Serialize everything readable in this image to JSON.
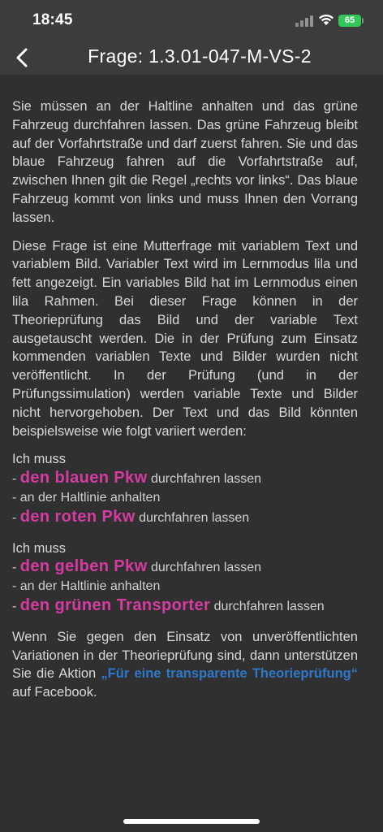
{
  "status_bar": {
    "time": "18:45",
    "battery": "65"
  },
  "nav": {
    "title": "Frage: 1.3.01-047-M-VS-2",
    "back_icon": "chevron-left-icon"
  },
  "content": {
    "paragraph1": "Sie müssen an der Haltline anhalten und das grüne Fahrzeug durchfahren lassen. Das grüne Fahrzeug bleibt auf der Vorfahrtstraße und darf zuerst fahren. Sie und das blaue Fahrzeug fahren auf die Vorfahrtstraße auf, zwischen Ihnen gilt die Regel „rechts vor links“. Das blaue Fahrzeug kommt von links und muss Ihnen den Vorrang lassen.",
    "paragraph2": "Diese Frage ist eine Mutterfrage mit variablem Text und variablem Bild. Variabler Text wird im Lernmodus lila und fett angezeigt. Ein variables Bild hat im Lernmodus einen lila Rahmen. Bei dieser Frage können in der Theorieprüfung das Bild und der variable Text ausgetauscht werden. Die in der Prüfung zum Einsatz kommenden variablen Texte und Bilder wurden nicht veröffentlicht. In der Prüfung (und in der Prüfungssimulation) werden variable Texte und Bilder nicht hervorgehoben. Der Text und das Bild könnten beispielsweise wie folgt variiert werden:",
    "example1": {
      "intro": "Ich muss",
      "line1_dash": "- ",
      "line1_var": "den blauen Pkw",
      "line1_rest": " durchfahren lassen",
      "line2": "- an der Haltlinie anhalten",
      "line3_dash": "- ",
      "line3_var": "den roten Pkw",
      "line3_rest": " durchfahren lassen"
    },
    "example2": {
      "intro": "Ich muss",
      "line1_dash": "- ",
      "line1_var": "den gelben Pkw",
      "line1_rest": " durchfahren lassen",
      "line2": "- an der Haltlinie anhalten",
      "line3_dash": "- ",
      "line3_var": "den grünen Transporter",
      "line3_rest": " durchfahren lassen"
    },
    "closing_text_before": "Wenn Sie gegen den Einsatz von unveröffentlichten Variationen in der Theorieprüfung sind, dann unterstützen Sie die Aktion ",
    "closing_link": "„Für eine transparente Theorieprüfung“",
    "closing_text_after": " auf Facebook."
  },
  "colors": {
    "background": "#303030",
    "topbar": "#3c3c3c",
    "variable_text": "#d63ba2",
    "link": "#2f78c8",
    "battery": "#33c759"
  }
}
